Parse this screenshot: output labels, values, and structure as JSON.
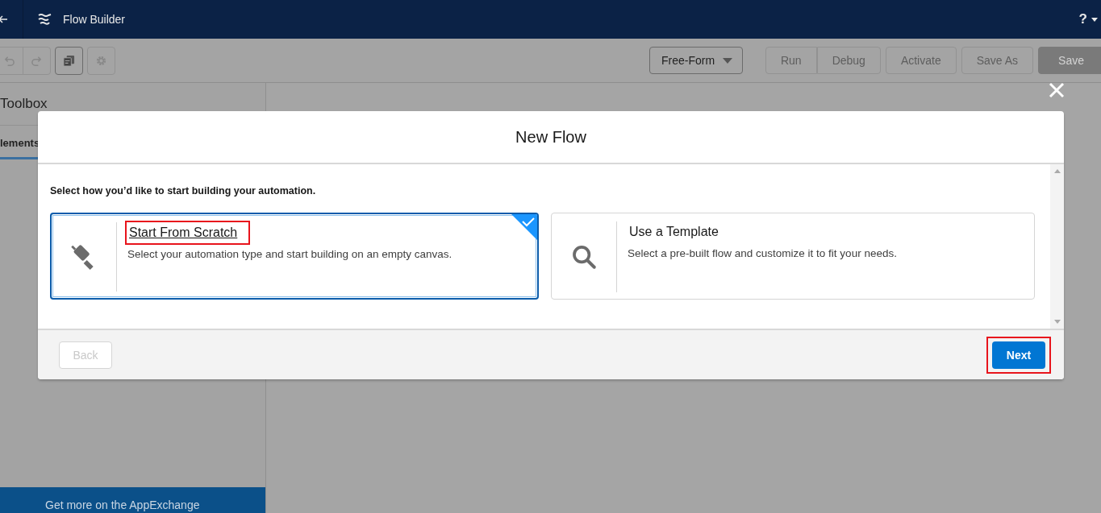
{
  "header": {
    "title": "Flow Builder",
    "help": "?"
  },
  "toolbar": {
    "layout_menu": "Free-Form",
    "buttons": [
      {
        "label": "Run",
        "kind": "neutral",
        "disabled": true
      },
      {
        "label": "Debug",
        "kind": "neutral",
        "disabled": true
      },
      {
        "label": "Activate",
        "kind": "neutral",
        "disabled": true
      },
      {
        "label": "Save As",
        "kind": "neutral",
        "disabled": true
      },
      {
        "label": "Save",
        "kind": "brand",
        "disabled": true
      }
    ]
  },
  "sidebar": {
    "title": "Toolbox",
    "tabs": [
      {
        "label": "lements",
        "selected": true
      }
    ],
    "footer_link": "Get more on the AppExchange"
  },
  "modal": {
    "title": "New Flow",
    "prompt": "Select how you’d like to start building your automation.",
    "options": [
      {
        "kind": "scratch",
        "title": "Start From Scratch",
        "description": "Select your automation type and start building on an empty canvas.",
        "selected": true,
        "highlighted": true
      },
      {
        "kind": "template",
        "title": "Use a Template",
        "description": "Select a pre-built flow and customize it to fit your needs.",
        "selected": false,
        "highlighted": false
      }
    ],
    "back_button": {
      "label": "Back",
      "disabled": true
    },
    "next_button": {
      "label": "Next",
      "disabled": false,
      "highlighted": true
    }
  }
}
